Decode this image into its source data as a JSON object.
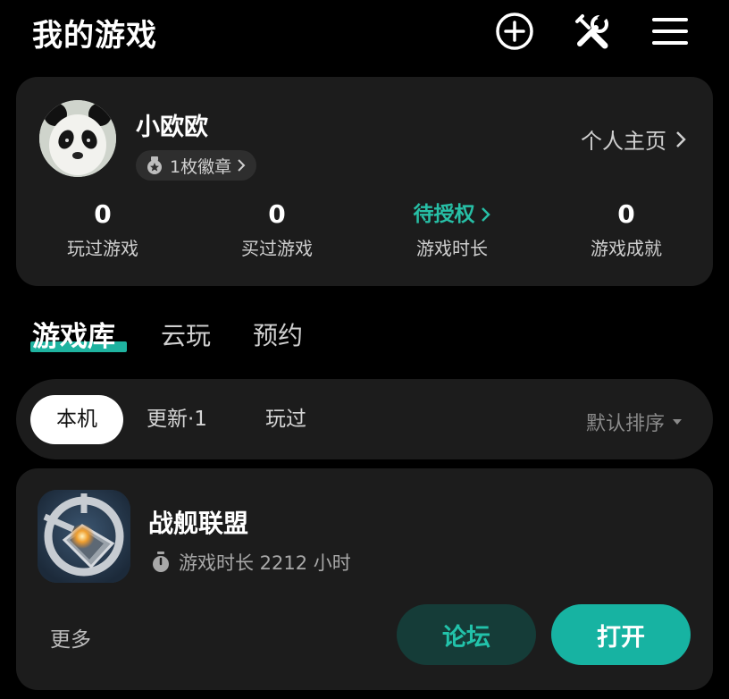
{
  "header": {
    "title": "我的游戏",
    "icons": [
      "add-circle-icon",
      "tools-icon",
      "menu-icon"
    ]
  },
  "profile": {
    "username": "小欧欧",
    "badge_label": "1枚徽章",
    "homepage_label": "个人主页",
    "stats": [
      {
        "value": "0",
        "label": "玩过游戏"
      },
      {
        "value": "0",
        "label": "买过游戏"
      },
      {
        "value": "待授权",
        "label": "游戏时长"
      },
      {
        "value": "0",
        "label": "游戏成就"
      }
    ]
  },
  "tabs": [
    {
      "label": "游戏库",
      "active": true
    },
    {
      "label": "云玩",
      "active": false
    },
    {
      "label": "预约",
      "active": false
    }
  ],
  "filters": {
    "chips": [
      {
        "label": "本机",
        "active": true
      },
      {
        "label": "更新·1",
        "active": false
      },
      {
        "label": "玩过",
        "active": false
      }
    ],
    "sort_label": "默认排序"
  },
  "game": {
    "name": "战舰联盟",
    "playtime": "游戏时长 2212 小时",
    "more_label": "更多",
    "forum_label": "论坛",
    "open_label": "打开"
  },
  "colors": {
    "accent": "#17b3a2",
    "accent_text": "#27bfa6",
    "card_bg": "#1c1c1c",
    "page_bg": "#000000"
  }
}
